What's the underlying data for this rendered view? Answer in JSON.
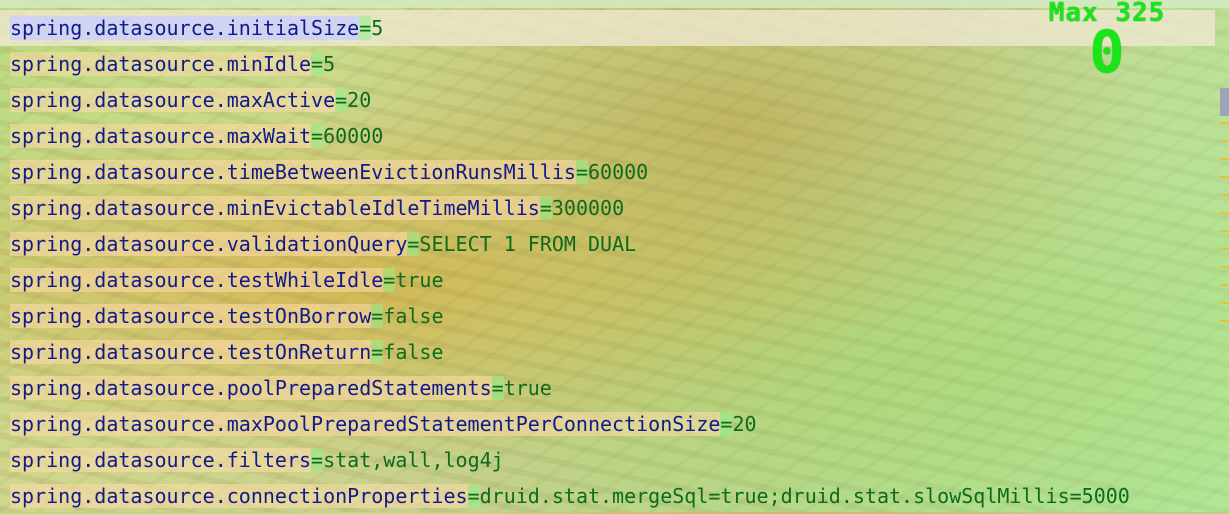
{
  "editor": {
    "lines": [
      {
        "key": "spring.datasource.initialSize",
        "value": "5"
      },
      {
        "key": "spring.datasource.minIdle",
        "value": "5"
      },
      {
        "key": "spring.datasource.maxActive",
        "value": "20"
      },
      {
        "key": "spring.datasource.maxWait",
        "value": "60000"
      },
      {
        "key": "spring.datasource.timeBetweenEvictionRunsMillis",
        "value": "60000"
      },
      {
        "key": "spring.datasource.minEvictableIdleTimeMillis",
        "value": "300000"
      },
      {
        "key": "spring.datasource.validationQuery",
        "value": "SELECT 1 FROM DUAL"
      },
      {
        "key": "spring.datasource.testWhileIdle",
        "value": "true"
      },
      {
        "key": "spring.datasource.testOnBorrow",
        "value": "false"
      },
      {
        "key": "spring.datasource.testOnReturn",
        "value": "false"
      },
      {
        "key": "spring.datasource.poolPreparedStatements",
        "value": "true"
      },
      {
        "key": "spring.datasource.maxPoolPreparedStatementPerConnectionSize",
        "value": "20"
      },
      {
        "key": "spring.datasource.filters",
        "value": "stat,wall,log4j"
      },
      {
        "key": "spring.datasource.connectionProperties",
        "value": "druid.stat.mergeSql=true;druid.stat.slowSqlMillis=5000"
      }
    ],
    "separator": "="
  },
  "hud": {
    "max_label": "Max 325",
    "counter": "0"
  },
  "colors": {
    "key": "#101a8a",
    "value": "#0c6b1c",
    "hud": "#19e619"
  }
}
